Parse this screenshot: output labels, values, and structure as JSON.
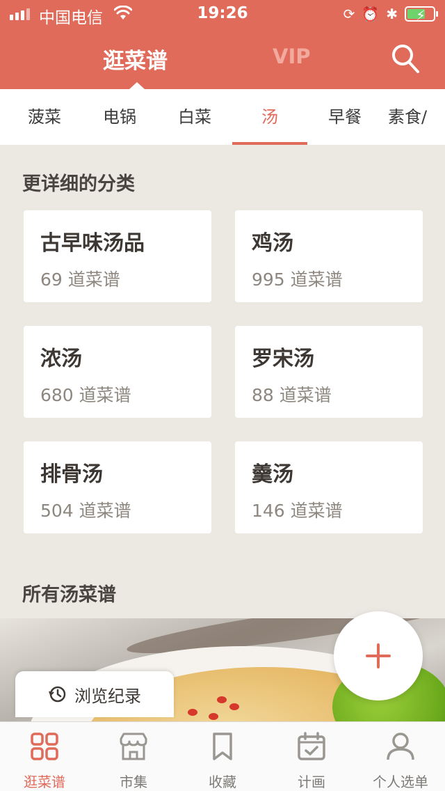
{
  "status_bar": {
    "carrier": "中国电信",
    "time": "19:26",
    "icons": [
      "signal-icon",
      "wifi-icon",
      "rotation-lock-icon",
      "alarm-icon",
      "bluetooth-icon",
      "battery-charging-icon"
    ]
  },
  "header": {
    "tab_main": "逛菜谱",
    "tab_vip": "VIP",
    "search_icon": "search-icon"
  },
  "categories": [
    {
      "label": "菠菜",
      "active": false
    },
    {
      "label": "电锅",
      "active": false
    },
    {
      "label": "白菜",
      "active": false
    },
    {
      "label": "汤",
      "active": true
    },
    {
      "label": "早餐",
      "active": false
    },
    {
      "label": "素食/",
      "active": false
    }
  ],
  "subcategory_section": {
    "title": "更详细的分类",
    "cards": [
      {
        "name": "古早味汤品",
        "count": "69 道菜谱"
      },
      {
        "name": "鸡汤",
        "count": "995 道菜谱"
      },
      {
        "name": "浓汤",
        "count": "680 道菜谱"
      },
      {
        "name": "罗宋汤",
        "count": "88 道菜谱"
      },
      {
        "name": "排骨汤",
        "count": "504 道菜谱"
      },
      {
        "name": "羹汤",
        "count": "146 道菜谱"
      }
    ]
  },
  "all_section": {
    "title": "所有汤菜谱"
  },
  "history_button": {
    "label": "浏览纪录",
    "icon": "history-clock-icon"
  },
  "fab": {
    "icon": "plus-icon"
  },
  "bottom_nav": [
    {
      "label": "逛菜谱",
      "icon": "grid-icon",
      "active": true
    },
    {
      "label": "市集",
      "icon": "store-icon",
      "active": false
    },
    {
      "label": "收藏",
      "icon": "bookmark-icon",
      "active": false
    },
    {
      "label": "计画",
      "icon": "calendar-check-icon",
      "active": false
    },
    {
      "label": "个人选单",
      "icon": "user-icon",
      "active": false
    }
  ],
  "colors": {
    "accent": "#e06b5a",
    "background": "#ece9e3",
    "card": "#ffffff"
  }
}
